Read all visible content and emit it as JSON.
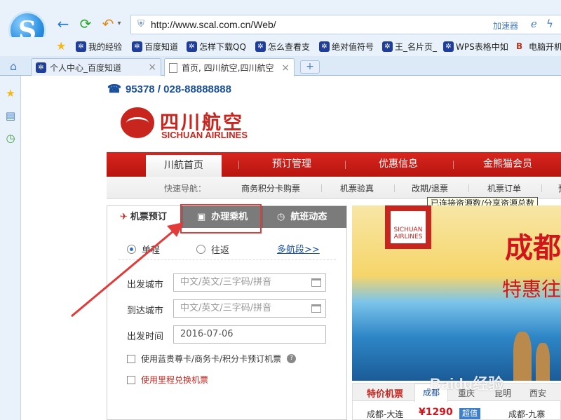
{
  "browser": {
    "address": "http://www.scal.com.cn/Web/",
    "accelerator_label": "加速器",
    "bookmarks": [
      "我的经验",
      "百度知道",
      "怎样下载QQ",
      "怎么查看支",
      "绝对值符号",
      "王_名片页_",
      "WPS表格中如",
      "电脑开机"
    ],
    "tabs": [
      {
        "label": "个人中心_百度知道"
      },
      {
        "label": "首页, 四川航空,四川航空"
      }
    ],
    "new_tab": "+"
  },
  "site": {
    "phone": "95378 / 028-88888888",
    "brand_cn": "四川航空",
    "brand_en": "SICHUAN AIRLINES",
    "main_nav": [
      "川航首页",
      "预订管理",
      "优惠信息",
      "金熊猫会员"
    ],
    "sub_nav_label": "快速导航：",
    "sub_nav": [
      "商务积分卡购票",
      "机票验真",
      "改期/退票",
      "机票订单",
      "预"
    ],
    "tooltip": "已连接资源数/分享资源总数"
  },
  "booking": {
    "tabs": [
      "机票预订",
      "办理乘机",
      "航班动态"
    ],
    "trip_types": [
      "单程",
      "往返"
    ],
    "multi_segment": "多航段>>",
    "fields": [
      {
        "label": "出发城市",
        "placeholder": "中文/英文/三字码/拼音"
      },
      {
        "label": "到达城市",
        "placeholder": "中文/英文/三字码/拼音"
      },
      {
        "label": "出发时间",
        "value": "2016-07-06"
      }
    ],
    "checkbox_card": "使用蓝贵尊卡/商务卡/积分卡预订机票",
    "checkbox_miles": "使用里程兑换机票"
  },
  "banner": {
    "logo_text": "SICHUAN AIRLINES",
    "title": "成都",
    "subtitle": "特惠往"
  },
  "fares": {
    "title": "特价机票",
    "cities": [
      "成都",
      "重庆",
      "昆明",
      "西安"
    ],
    "routes": [
      {
        "route": "成都-大连",
        "price": "¥1290",
        "badge": "超值"
      },
      {
        "route": "成都-九寨"
      }
    ]
  },
  "watermark": "Baidu经验",
  "colors": {
    "brand_red": "#c9251f",
    "nav_red": "#d2261f",
    "highlight": "#e33a3a"
  }
}
